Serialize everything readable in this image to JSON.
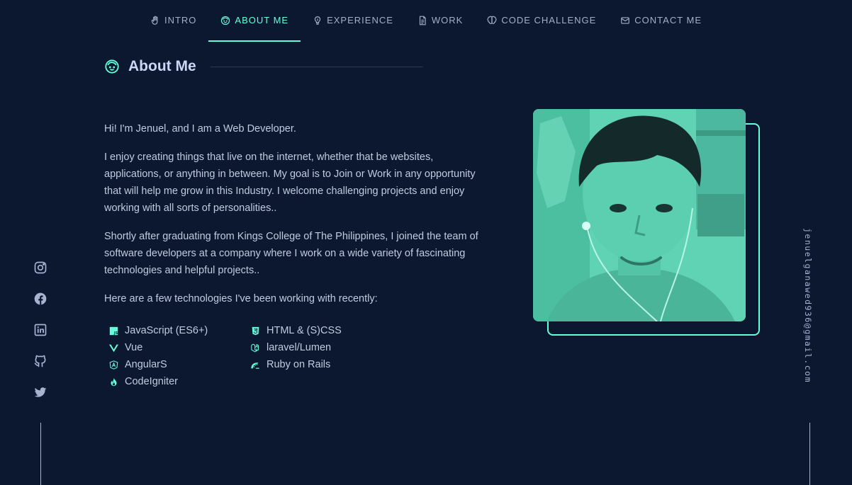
{
  "nav": {
    "items": [
      {
        "label": "Intro",
        "icon": "hand-icon"
      },
      {
        "label": "About Me",
        "icon": "face-icon",
        "active": true
      },
      {
        "label": "Experience",
        "icon": "lightbulb-icon"
      },
      {
        "label": "Work",
        "icon": "document-icon"
      },
      {
        "label": "Code Challenge",
        "icon": "brain-icon"
      },
      {
        "label": "Contact Me",
        "icon": "mail-icon"
      }
    ]
  },
  "section": {
    "title": "About Me",
    "icon": "face-icon"
  },
  "about": {
    "paragraphs": [
      "Hi! I'm Jenuel, and I am a Web Developer.",
      "I enjoy creating things that live on the internet, whether that be websites, applications, or anything in between. My goal is to Join or Work in any opportunity that will help me grow in this Industry. I welcome challenging projects and enjoy working with all sorts of personalities..",
      "Shortly after graduating from Kings College of The Philippines, I joined the team of software developers at a company where I work on a wide variety of fascinating technologies and helpful projects..",
      "Here are a few technologies I've been working with recently:"
    ]
  },
  "technologies": [
    {
      "label": "JavaScript (ES6+)",
      "icon": "javascript-icon"
    },
    {
      "label": "HTML & (S)CSS",
      "icon": "html5-icon"
    },
    {
      "label": "Vue",
      "icon": "vue-icon"
    },
    {
      "label": "laravel/Lumen",
      "icon": "laravel-icon"
    },
    {
      "label": "AngularS",
      "icon": "angular-icon"
    },
    {
      "label": "Ruby on Rails",
      "icon": "rails-icon"
    },
    {
      "label": "CodeIgniter",
      "icon": "codeigniter-icon"
    }
  ],
  "social": [
    "instagram-icon",
    "facebook-icon",
    "linkedin-icon",
    "github-icon",
    "twitter-icon"
  ],
  "email": "jenuelganawed936@gmail.com",
  "colors": {
    "background": "#0b1830",
    "accent": "#64ffda",
    "text": "#c1cbe0",
    "heading": "#ccd6f6"
  }
}
